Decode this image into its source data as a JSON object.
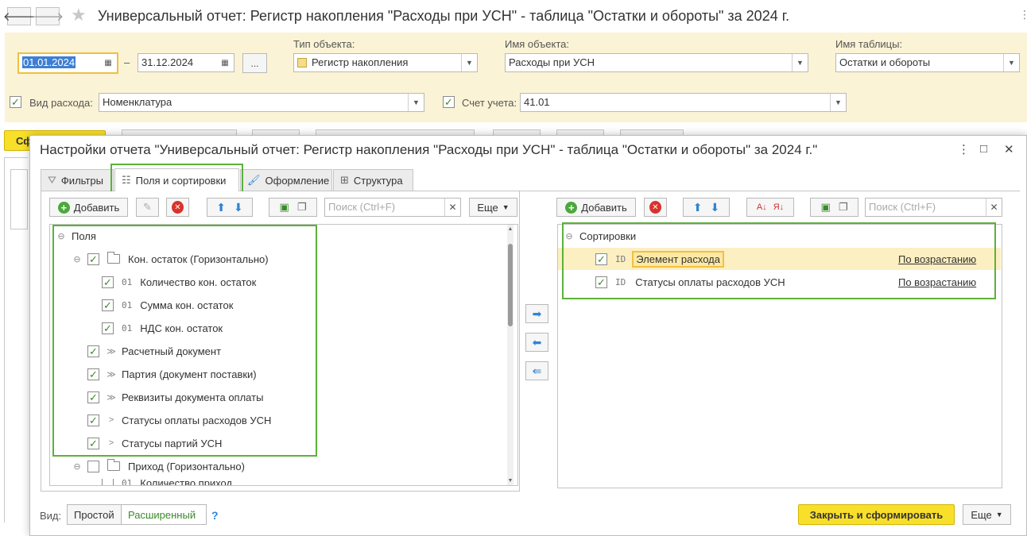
{
  "window": {
    "title": "Универсальный отчет: Регистр накопления \"Расходы при УСН\" - таблица \"Остатки и обороты\" за 2024 г.",
    "back_icon": "arrow-left-icon",
    "forward_icon": "arrow-right-icon",
    "favorite_icon": "star-icon"
  },
  "params": {
    "date_from": "01.01.2024",
    "date_sep": "–",
    "date_to": "31.12.2024",
    "period_button": "...",
    "object_type_label": "Тип объекта:",
    "object_type_value": "Регистр накопления",
    "object_name_label": "Имя объекта:",
    "object_name_value": "Расходы при УСН",
    "table_name_label": "Имя таблицы:",
    "table_name_value": "Остатки и обороты",
    "expense_type_label": "Вид расхода:",
    "expense_type_value": "Номенклатура",
    "account_label": "Счет учета:",
    "account_value": "41.01",
    "form_button_partial": "Сф"
  },
  "dialog": {
    "title": "Настройки отчета \"Универсальный отчет: Регистр накопления \"Расходы при УСН\" - таблица \"Остатки и обороты\" за 2024 г.\"",
    "menu_icon": "⋮",
    "maximize_icon": "□",
    "close_icon": "✕",
    "tabs": [
      {
        "label": "Фильтры"
      },
      {
        "label": "Поля и сортировки"
      },
      {
        "label": "Оформление"
      },
      {
        "label": "Структура"
      }
    ],
    "left_toolbar": {
      "add": "Добавить",
      "search_placeholder": "Поиск (Ctrl+F)",
      "more": "Еще"
    },
    "fields_tree": {
      "root": "Поля",
      "group1": "Кон. остаток (Горизонтально)",
      "group1_items": [
        {
          "tag": "01",
          "label": "Количество кон. остаток"
        },
        {
          "tag": "01",
          "label": "Сумма кон. остаток"
        },
        {
          "tag": "01",
          "label": "НДС кон. остаток"
        }
      ],
      "items": [
        {
          "marker": "≫",
          "label": "Расчетный документ"
        },
        {
          "marker": "≫",
          "label": "Партия (документ поставки)"
        },
        {
          "marker": "≫",
          "label": "Реквизиты документа оплаты"
        },
        {
          "marker": ">",
          "label": "Статусы оплаты расходов УСН"
        },
        {
          "marker": ">",
          "label": "Статусы партий УСН"
        }
      ],
      "group2": "Приход (Горизонтально)",
      "group2_partial": {
        "tag": "01",
        "label": "Количество приход"
      }
    },
    "right_toolbar": {
      "add": "Добавить",
      "search_placeholder": "Поиск (Ctrl+F)"
    },
    "sort_tree": {
      "root": "Сортировки",
      "rows": [
        {
          "tag": "ID",
          "label": "Элемент расхода",
          "order": "По возрастанию"
        },
        {
          "tag": "ID",
          "label": "Статусы оплаты расходов УСН",
          "order": "По возрастанию"
        }
      ]
    },
    "footer": {
      "view_label": "Вид:",
      "simple": "Простой",
      "extended": "Расширенный",
      "help": "?",
      "close_and_form": "Закрыть и сформировать",
      "more": "Еще"
    }
  },
  "colors": {
    "accent_yellow": "#f8df2a",
    "param_bg": "#fbf3d5",
    "highlight_green": "#5cb13a",
    "check_green": "#3a8a2a"
  }
}
